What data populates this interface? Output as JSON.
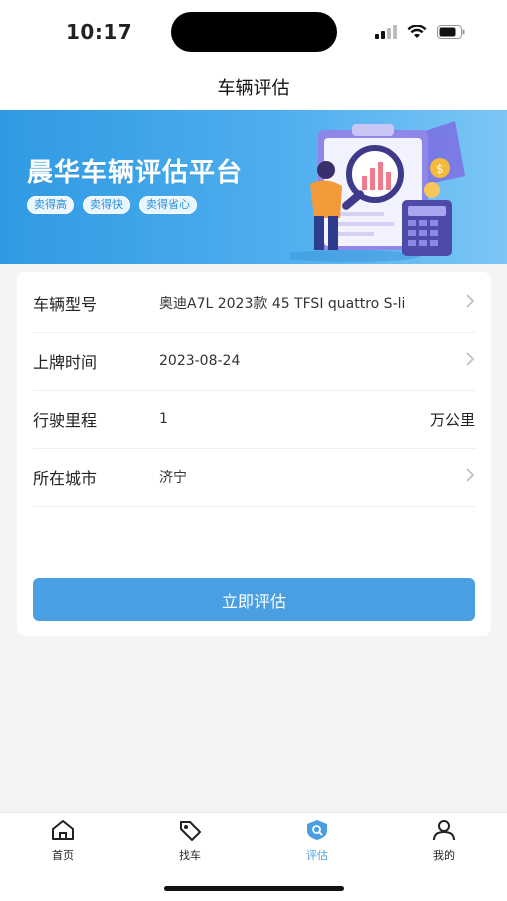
{
  "status_bar": {
    "time": "10:17"
  },
  "nav": {
    "title": "车辆评估"
  },
  "banner": {
    "title": "晨华车辆评估平台",
    "tags": [
      "卖得高",
      "卖得快",
      "卖得省心"
    ]
  },
  "form": {
    "rows": [
      {
        "label": "车辆型号",
        "value": "奥迪A7L 2023款 45 TFSI quattro S-li",
        "has_arrow": true
      },
      {
        "label": "上牌时间",
        "value": "2023-08-24",
        "has_arrow": true
      },
      {
        "label": "行驶里程",
        "value": "1",
        "unit": "万公里"
      },
      {
        "label": "所在城市",
        "value": "济宁",
        "has_arrow": true
      }
    ],
    "submit_label": "立即评估"
  },
  "tabbar": {
    "items": [
      {
        "label": "首页",
        "icon": "home-icon"
      },
      {
        "label": "找车",
        "icon": "tag-icon"
      },
      {
        "label": "评估",
        "icon": "evaluate-icon",
        "active": true
      },
      {
        "label": "我的",
        "icon": "user-icon"
      }
    ]
  },
  "colors": {
    "accent": "#4a9fe3",
    "banner": "#3ea3ea"
  }
}
